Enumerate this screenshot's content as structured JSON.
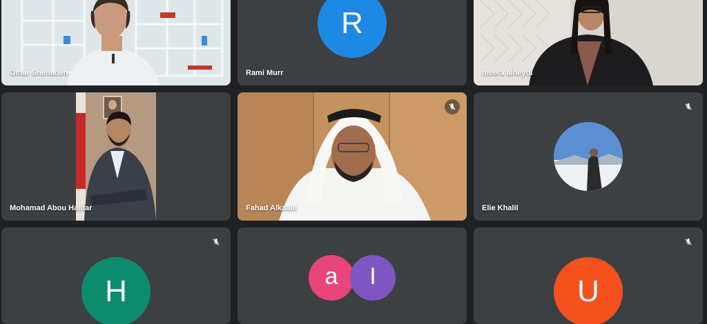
{
  "participants": [
    {
      "name": "Omar Shehadeh"
    },
    {
      "name": "Rami Murr",
      "initial": "R",
      "color": "#1e88e5"
    },
    {
      "name": "meera alneydi"
    },
    {
      "name": "Mohamad Abou Haidar"
    },
    {
      "name": "Fahad Alkaabi"
    },
    {
      "name": "Elie Khalil"
    },
    {
      "initial": "H",
      "color": "#0d8b6f"
    },
    {
      "initial_a": "a",
      "initial_b": "I",
      "color_a": "#e8457a",
      "color_b": "#7e57c2"
    },
    {
      "initial": "U",
      "color": "#f4511e"
    }
  ],
  "colors": {
    "tile": "#3c4043",
    "background": "#202124",
    "active_speaker_border": "#8ab4f8"
  },
  "icons": {
    "muted": "mic-off-icon"
  }
}
